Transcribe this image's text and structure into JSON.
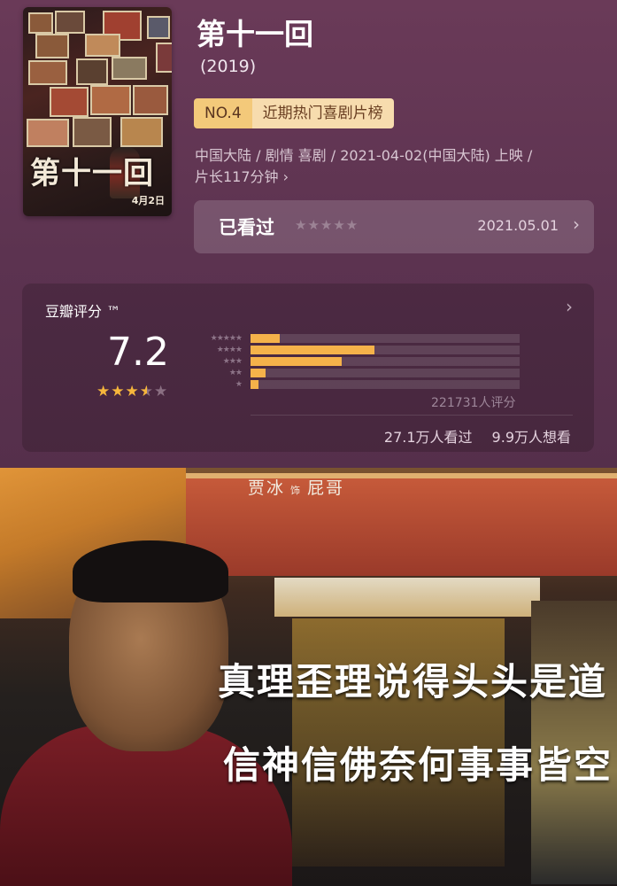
{
  "movie": {
    "title": "第十一回",
    "year": "(2019)",
    "rank_no": "NO.4",
    "rank_list": "近期热门喜剧片榜",
    "meta_line1": "中国大陆 / 剧情 喜剧 / 2021-04-02(中国大陆) 上映 /",
    "meta_line2": "片长117分钟 ›"
  },
  "poster": {
    "title_text": "第十一回",
    "date_text": "4月2日"
  },
  "watched": {
    "label": "已看过",
    "stars": "★★★★★",
    "date": "2021.05.01",
    "arrow": "›"
  },
  "rating": {
    "title": "豆瓣评分 ™",
    "score": "7.2",
    "stars_full": "★★★",
    "stars_half": "★",
    "stars_empty": "★",
    "distribution": [
      {
        "label": "★★★★★",
        "fraction": 0.11
      },
      {
        "label": "★★★★",
        "fraction": 0.46
      },
      {
        "label": "★★★",
        "fraction": 0.34
      },
      {
        "label": "★★",
        "fraction": 0.055
      },
      {
        "label": "★",
        "fraction": 0.03
      }
    ],
    "total": "221731人评分",
    "watched_count": "27.1万人看过",
    "want_count": "9.9万人想看",
    "arrow": "›"
  },
  "still": {
    "credit_actor": "贾冰",
    "credit_sep": "饰",
    "credit_role": "屁哥",
    "caption_line1": "真理歪理说得头头是道",
    "caption_line2": "信神信佛奈何事事皆空"
  },
  "colors": {
    "background": "#5e3450",
    "star": "#f6b63c",
    "rank_badge": "#f3c97a"
  }
}
